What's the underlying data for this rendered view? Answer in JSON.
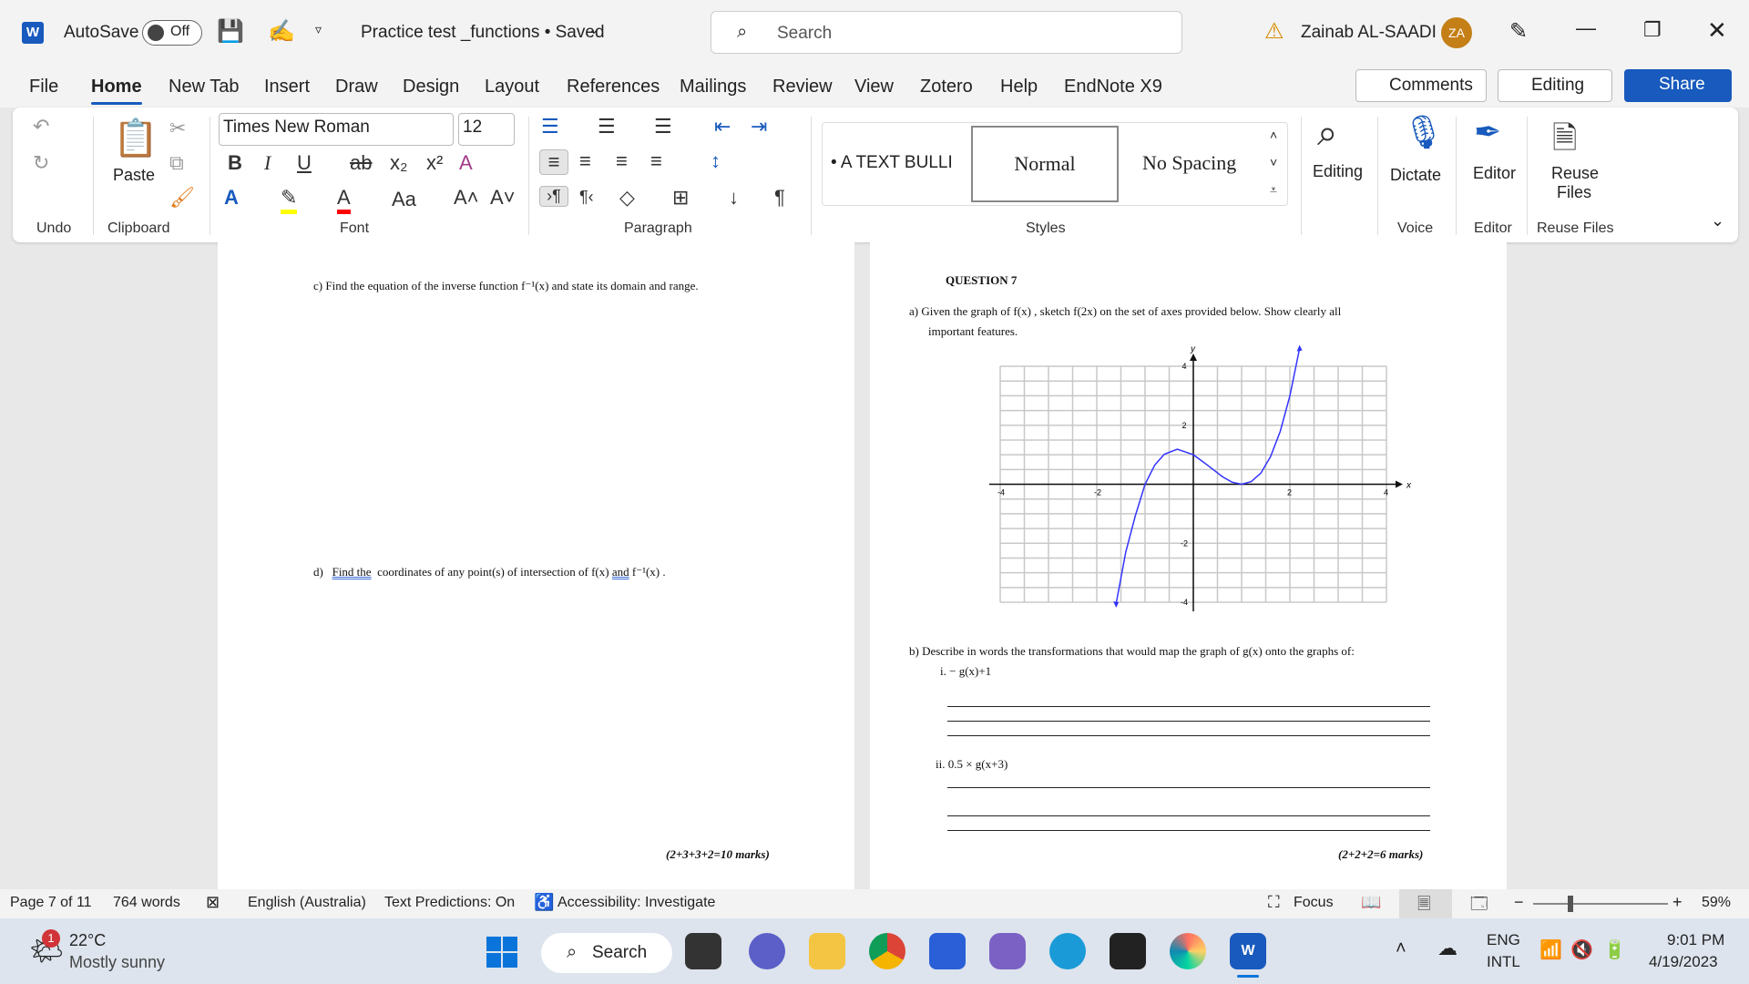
{
  "titlebar": {
    "autosave_label": "AutoSave",
    "autosave_state": "Off",
    "doc_title": "Practice test _functions • Saved",
    "search_placeholder": "Search",
    "user_name": "Zainab AL-SAADI",
    "user_initials": "ZA"
  },
  "menu": {
    "tabs": [
      "File",
      "Home",
      "New Tab",
      "Insert",
      "Draw",
      "Design",
      "Layout",
      "References",
      "Mailings",
      "Review",
      "View",
      "Zotero",
      "Help",
      "EndNote X9"
    ],
    "active": "Home",
    "comments": "Comments",
    "editing": "Editing",
    "share": "Share"
  },
  "ribbon": {
    "groups": {
      "undo": "Undo",
      "clipboard": "Clipboard",
      "font": "Font",
      "paragraph": "Paragraph",
      "styles": "Styles",
      "voice": "Voice",
      "editor": "Editor",
      "reuse": "Reuse Files"
    },
    "paste": "Paste",
    "font_name": "Times New Roman",
    "font_size": "12",
    "styles": [
      "• A TEXT BULLI",
      "Normal",
      "No Spacing"
    ],
    "editing": "Editing",
    "dictate": "Dictate",
    "editor": "Editor",
    "reuse_files": "Reuse Files",
    "colors": {
      "highlight": "#ffff00",
      "font_color": "#ff0000",
      "accent": "#185abd"
    }
  },
  "left_page": {
    "c": "c)  Find the equation of the inverse function  f⁻¹(x)  and state its domain and range.",
    "d_prefix": "d)",
    "d_find": "Find  the",
    "d_mid": "coordinates of any point(s) of intersection of  f(x) ",
    "d_and": "and",
    "d_end": " f⁻¹(x) .",
    "marks": "(2+3+3+2=10 marks)"
  },
  "right_page": {
    "heading": "QUESTION 7",
    "a_line1": "a)  Given the graph of f(x) , sketch  f(2x)  on the set of axes provided below. Show clearly all",
    "a_line2": "important features.",
    "b": "b)  Describe in words the transformations that would map the graph of   g(x) onto the graphs of:",
    "b_i": "i. − g(x)+1",
    "b_ii": "ii. 0.5 × g(x+3)",
    "marks": "(2+2+2=6 marks)"
  },
  "chart_data": {
    "type": "line",
    "xlabel": "x",
    "ylabel": "y",
    "xlim": [
      -4,
      4
    ],
    "ylim": [
      -4,
      4
    ],
    "grid": true,
    "grid_step": 0.5,
    "x_ticks": [
      "-4",
      "-2",
      "2",
      "4"
    ],
    "y_ticks": [
      "4",
      "2",
      "-2",
      "-4"
    ],
    "curve_color": "#3333ff",
    "points": [
      [
        -1.6,
        -4.06
      ],
      [
        -1.4,
        -2.3
      ],
      [
        -1.2,
        -1.06
      ],
      [
        -1,
        0
      ],
      [
        -0.8,
        0.65
      ],
      [
        -0.6,
        1.02
      ],
      [
        -0.333,
        1.19
      ],
      [
        0,
        1
      ],
      [
        0.3,
        0.64
      ],
      [
        0.6,
        0.26
      ],
      [
        0.8,
        0.07
      ],
      [
        1,
        0
      ],
      [
        1.2,
        0.09
      ],
      [
        1.4,
        0.38
      ],
      [
        1.6,
        0.94
      ],
      [
        1.8,
        1.79
      ],
      [
        2,
        3
      ],
      [
        2.2,
        4.6
      ]
    ]
  },
  "status": {
    "page": "Page 7 of 11",
    "words": "764 words",
    "language": "English (Australia)",
    "predictions": "Text Predictions: On",
    "accessibility": "Accessibility: Investigate",
    "focus": "Focus",
    "zoom": "59%"
  },
  "taskbar": {
    "temp": "22°C",
    "weather": "Mostly sunny",
    "badge": "1",
    "search": "Search",
    "lang1": "ENG",
    "lang2": "INTL",
    "time": "9:01 PM",
    "date": "4/19/2023"
  }
}
